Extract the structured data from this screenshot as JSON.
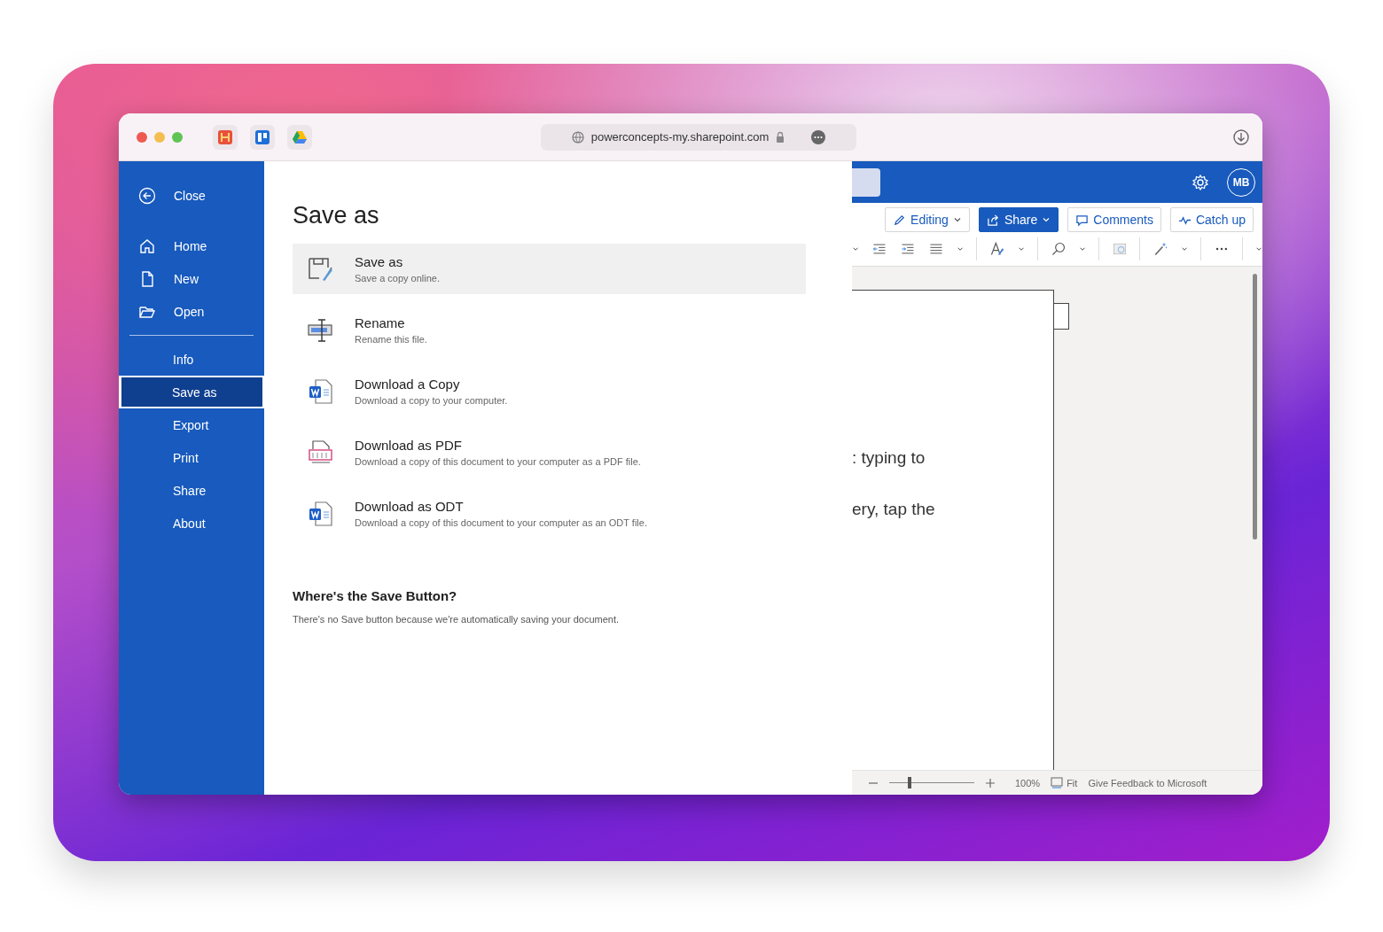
{
  "browser": {
    "url": "powerconcepts-my.sharepoint.com"
  },
  "sidebar": {
    "close": "Close",
    "items": [
      {
        "label": "Home",
        "selected": false
      },
      {
        "label": "New",
        "selected": false
      },
      {
        "label": "Open",
        "selected": false
      }
    ],
    "more_items": [
      {
        "label": "Info",
        "selected": false
      },
      {
        "label": "Save as",
        "selected": true
      },
      {
        "label": "Export",
        "selected": false
      },
      {
        "label": "Print",
        "selected": false
      },
      {
        "label": "Share",
        "selected": false
      },
      {
        "label": "About",
        "selected": false
      }
    ]
  },
  "panel": {
    "title": "Save as",
    "options": [
      {
        "title": "Save as",
        "description": "Save a copy online.",
        "selected": true
      },
      {
        "title": "Rename",
        "description": "Rename this file.",
        "selected": false
      },
      {
        "title": "Download a Copy",
        "description": "Download a copy to your computer.",
        "selected": false
      },
      {
        "title": "Download as PDF",
        "description": "Download a copy of this document to your computer as a PDF file.",
        "selected": false
      },
      {
        "title": "Download as ODT",
        "description": "Download a copy of this document to your computer as an ODT file.",
        "selected": false
      }
    ],
    "note": {
      "heading": "Where's the Save Button?",
      "text": "There's no Save button because we're automatically saving your document."
    }
  },
  "word": {
    "avatar": "MB",
    "buttons": [
      {
        "label": "Editing",
        "kind": "outline"
      },
      {
        "label": "Share",
        "kind": "primary"
      },
      {
        "label": "Comments",
        "kind": "outline"
      },
      {
        "label": "Catch up",
        "kind": "outline"
      }
    ],
    "document_lines": [
      ": typing to",
      "ery, tap the"
    ],
    "status": {
      "zoom": {
        "level": 0.22
      },
      "zoom_text": "100%",
      "fit": "Fit",
      "feedback": "Give Feedback to Microsoft"
    }
  }
}
